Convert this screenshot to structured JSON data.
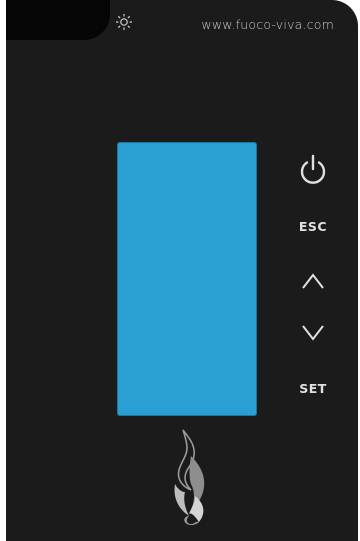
{
  "header": {
    "url_text": "www.fuoco-viva.com",
    "backlight_icon": "sun-icon"
  },
  "display": {
    "color": "#2a9fd3"
  },
  "controls": {
    "power_icon": "power-icon",
    "esc_label": "ESC",
    "up_icon": "chevron-up-icon",
    "down_icon": "chevron-down-icon",
    "set_label": "SET"
  },
  "logo": {
    "icon": "flame-icon"
  },
  "colors": {
    "panel": "#1b1b1b",
    "text": "#dcdcdc",
    "lcd": "#2a9fd3"
  }
}
